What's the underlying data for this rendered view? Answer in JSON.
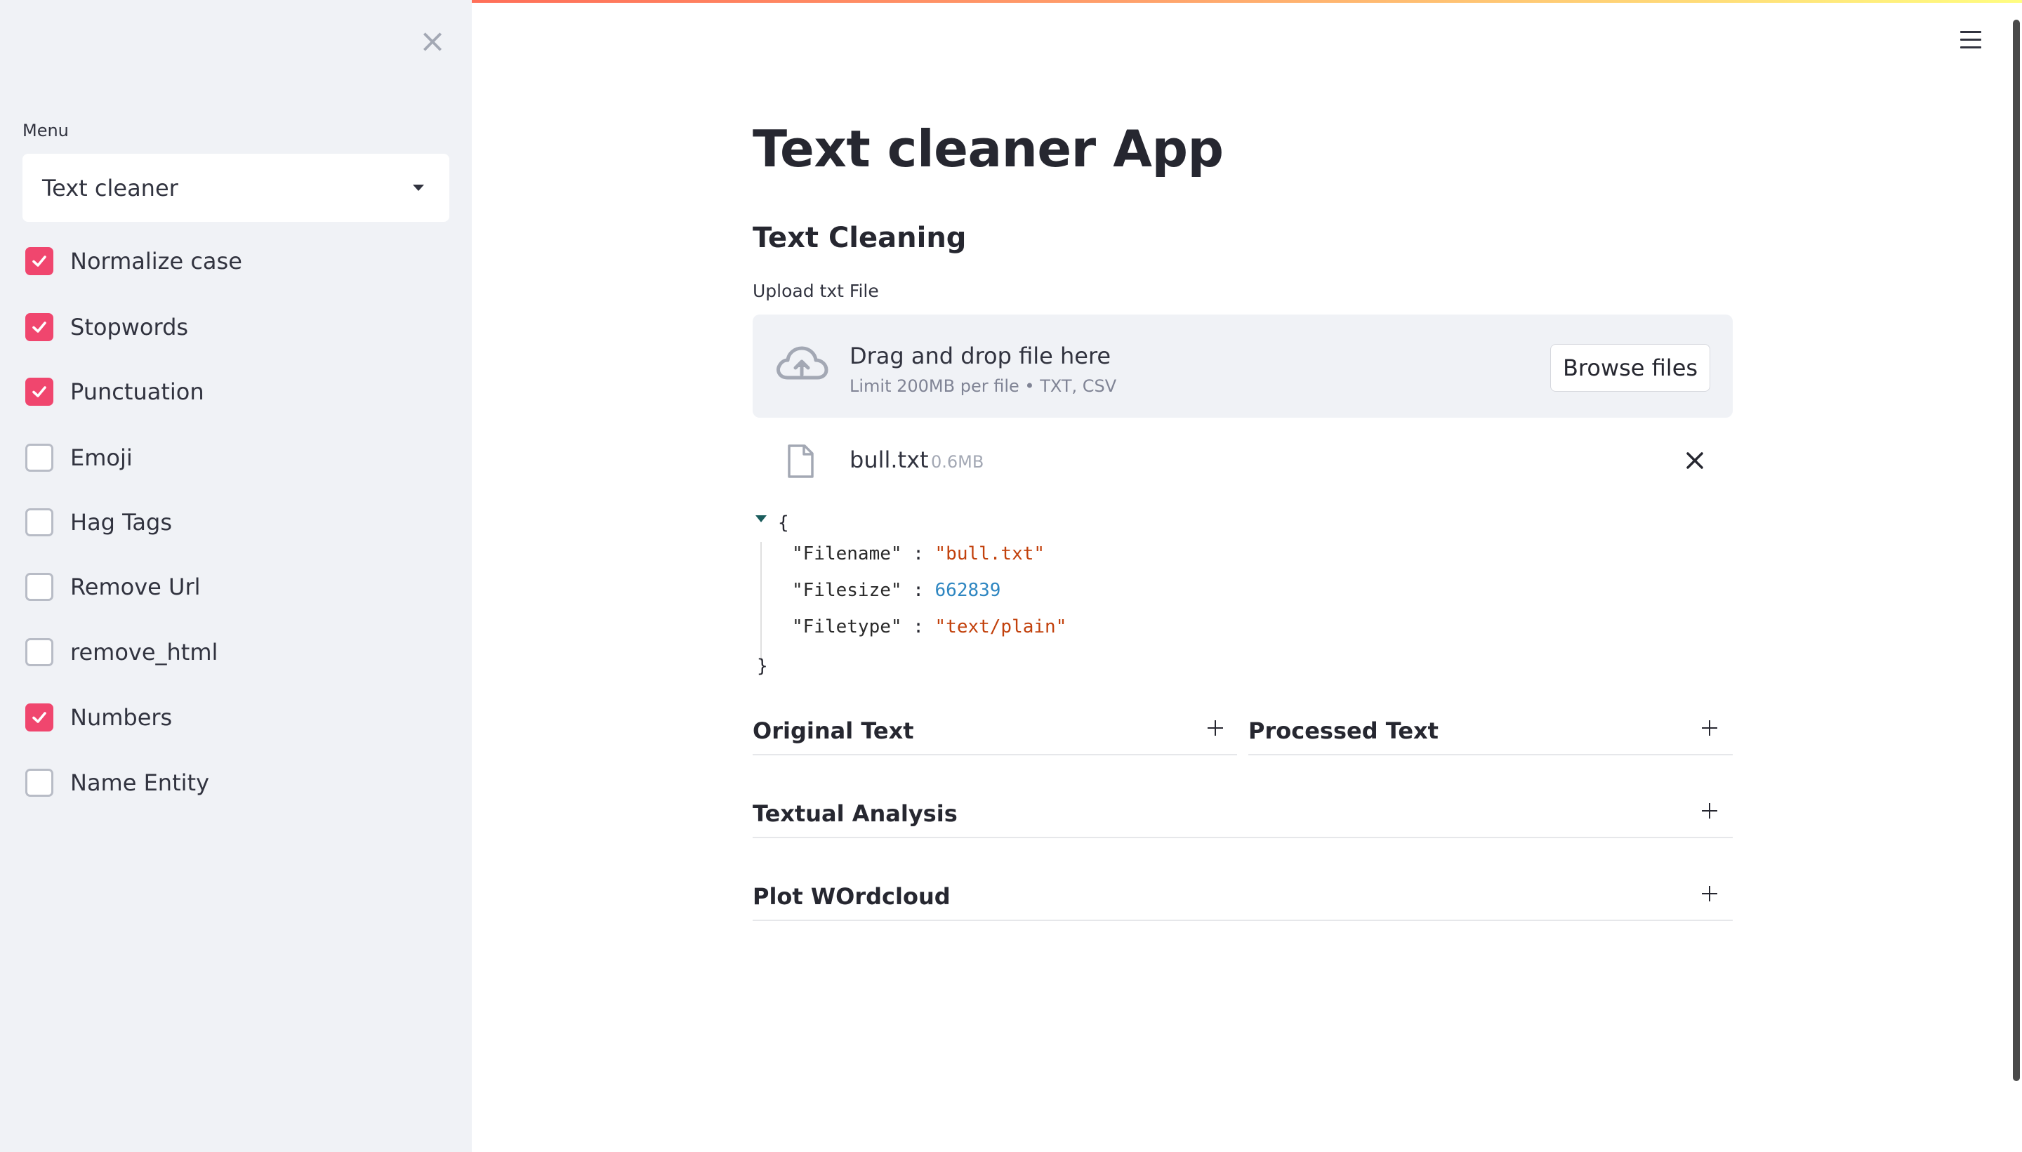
{
  "sidebar": {
    "close_icon": "close-icon",
    "menu_label": "Menu",
    "menu_select_value": "Text cleaner",
    "checkboxes": [
      {
        "label": "Normalize case",
        "checked": true
      },
      {
        "label": "Stopwords",
        "checked": true
      },
      {
        "label": "Punctuation",
        "checked": true
      },
      {
        "label": "Emoji",
        "checked": false
      },
      {
        "label": "Hag Tags",
        "checked": false
      },
      {
        "label": "Remove Url",
        "checked": false
      },
      {
        "label": "remove_html",
        "checked": false
      },
      {
        "label": "Numbers",
        "checked": true
      },
      {
        "label": "Name Entity",
        "checked": false
      }
    ]
  },
  "main": {
    "title": "Text cleaner App",
    "subtitle": "Text Cleaning",
    "uploader": {
      "label": "Upload txt File",
      "drop_title": "Drag and drop file here",
      "drop_sub": "Limit 200MB per file • TXT, CSV",
      "browse_label": "Browse files"
    },
    "file": {
      "name": "bull.txt",
      "size": "0.6MB"
    },
    "json_view": {
      "open": "{",
      "close": "}",
      "entries": [
        {
          "key": "\"Filename\"",
          "sep": " : ",
          "value": "\"bull.txt\"",
          "type": "string"
        },
        {
          "key": "\"Filesize\"",
          "sep": " : ",
          "value": "662839",
          "type": "number"
        },
        {
          "key": "\"Filetype\"",
          "sep": " : ",
          "value": "\"text/plain\"",
          "type": "string"
        }
      ]
    },
    "expanders": {
      "original": "Original Text",
      "processed": "Processed Text",
      "analysis": "Textual Analysis",
      "wordcloud": "Plot WOrdcloud"
    }
  },
  "colors": {
    "accent": "#f0466e",
    "sidebar_bg": "#f0f2f6",
    "json_string": "#c2410c",
    "json_number": "#2e86c1"
  }
}
